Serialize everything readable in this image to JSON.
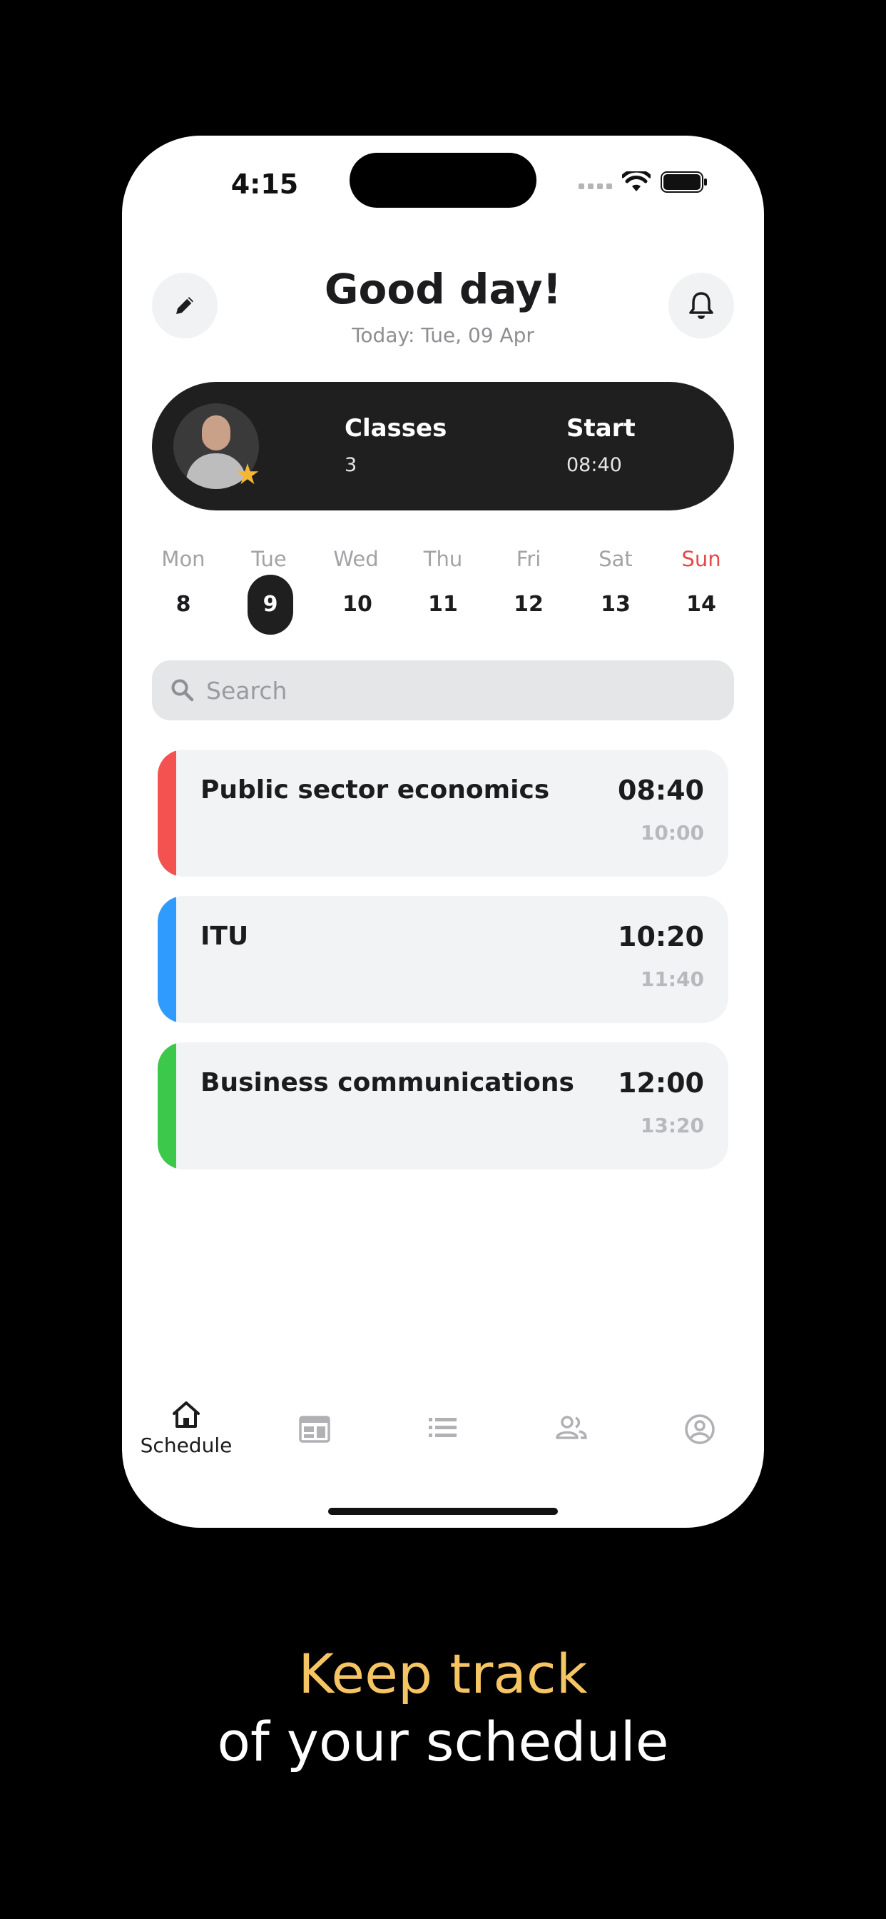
{
  "status_bar": {
    "time": "4:15"
  },
  "header": {
    "greeting": "Good day!",
    "date": "Today: Tue, 09 Apr",
    "edit_icon": "pencil-icon",
    "notification_icon": "bell-icon"
  },
  "summary": {
    "classes_label": "Classes",
    "classes_value": "3",
    "start_label": "Start",
    "start_value": "08:40",
    "star_color": "#f5b730"
  },
  "week": {
    "days": [
      {
        "name": "Mon",
        "num": "8"
      },
      {
        "name": "Tue",
        "num": "9",
        "selected": true
      },
      {
        "name": "Wed",
        "num": "10"
      },
      {
        "name": "Thu",
        "num": "11"
      },
      {
        "name": "Fri",
        "num": "12"
      },
      {
        "name": "Sat",
        "num": "13"
      },
      {
        "name": "Sun",
        "num": "14",
        "weekend": true
      }
    ],
    "weekend_color": "#e5484d"
  },
  "search": {
    "placeholder": "Search"
  },
  "lessons": [
    {
      "title": "Public sector economics",
      "start": "08:40",
      "end": "10:00",
      "color": "#f45151"
    },
    {
      "title": "ITU",
      "start": "10:20",
      "end": "11:40",
      "color": "#2f9bff"
    },
    {
      "title": "Business communications",
      "start": "12:00",
      "end": "13:20",
      "color": "#3cc84a"
    }
  ],
  "tabbar": {
    "items": [
      {
        "icon": "home-icon",
        "label": "Schedule",
        "active": true
      },
      {
        "icon": "calendar-icon",
        "label": ""
      },
      {
        "icon": "list-icon",
        "label": ""
      },
      {
        "icon": "people-icon",
        "label": ""
      },
      {
        "icon": "profile-icon",
        "label": ""
      }
    ]
  },
  "caption": {
    "line1": "Keep track",
    "line2": "of your schedule"
  }
}
